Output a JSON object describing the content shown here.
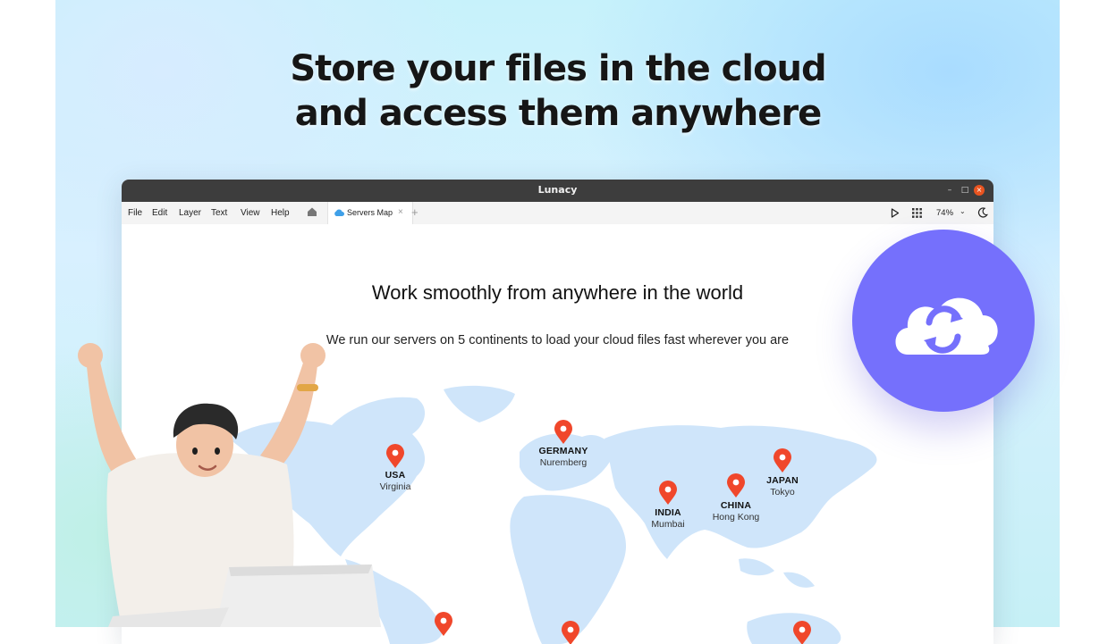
{
  "headline": {
    "line1": "Store your files in the cloud",
    "line2": "and access them anywhere"
  },
  "window": {
    "title": "Lunacy",
    "controls": [
      "–",
      "□",
      "×"
    ],
    "menu": [
      "File",
      "Edit",
      "Layer",
      "Text",
      "View",
      "Help"
    ],
    "tab": {
      "label": "Servers Map",
      "close": "×"
    },
    "new_tab": "+",
    "zoom": "74%",
    "zoom_chevron": "⌄"
  },
  "canvas": {
    "title": "Work smoothly from anywhere in the world",
    "subtitle": "We run our servers on 5 continents to load your cloud files fast wherever you are",
    "locations": [
      {
        "country": "USA",
        "city": "Virginia"
      },
      {
        "country": "GERMANY",
        "city": "Nuremberg"
      },
      {
        "country": "INDIA",
        "city": "Mumbai"
      },
      {
        "country": "CHINA",
        "city": "Hong Kong"
      },
      {
        "country": "JAPAN",
        "city": "Tokyo"
      }
    ]
  },
  "colors": {
    "pin": "#f0472b",
    "badge": "#7570fc",
    "map": "#cfe5fa",
    "titlebar": "#3d3d3d",
    "close": "#e95420"
  },
  "icons": [
    "cloud-sync-icon",
    "home-icon",
    "cloud-icon",
    "play-icon",
    "grid-icon",
    "moon-icon",
    "location-pin-icon"
  ]
}
